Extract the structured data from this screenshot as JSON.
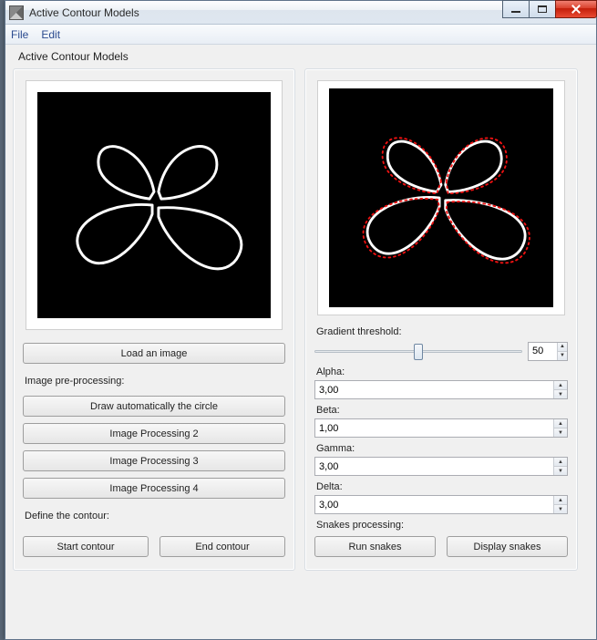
{
  "window": {
    "title": "Active Contour Models"
  },
  "menu": {
    "file": "File",
    "edit": "Edit"
  },
  "subtitle": "Active Contour Models",
  "left": {
    "load_image": "Load an image",
    "preproc_label": "Image pre-processing:",
    "draw_circle": "Draw automatically the circle",
    "proc2": "Image Processing 2",
    "proc3": "Image Processing 3",
    "proc4": "Image Processing 4",
    "define_contour_label": "Define the contour:",
    "start_contour": "Start contour",
    "end_contour": "End contour"
  },
  "right": {
    "grad_label": "Gradient threshold:",
    "grad_value": "50",
    "grad_percent": 50,
    "alpha_label": "Alpha:",
    "alpha_value": "3,00",
    "beta_label": "Beta:",
    "beta_value": "1,00",
    "gamma_label": "Gamma:",
    "gamma_value": "3,00",
    "delta_label": "Delta:",
    "delta_value": "3,00",
    "snakes_label": "Snakes processing:",
    "run_snakes": "Run snakes",
    "display_snakes": "Display snakes"
  }
}
